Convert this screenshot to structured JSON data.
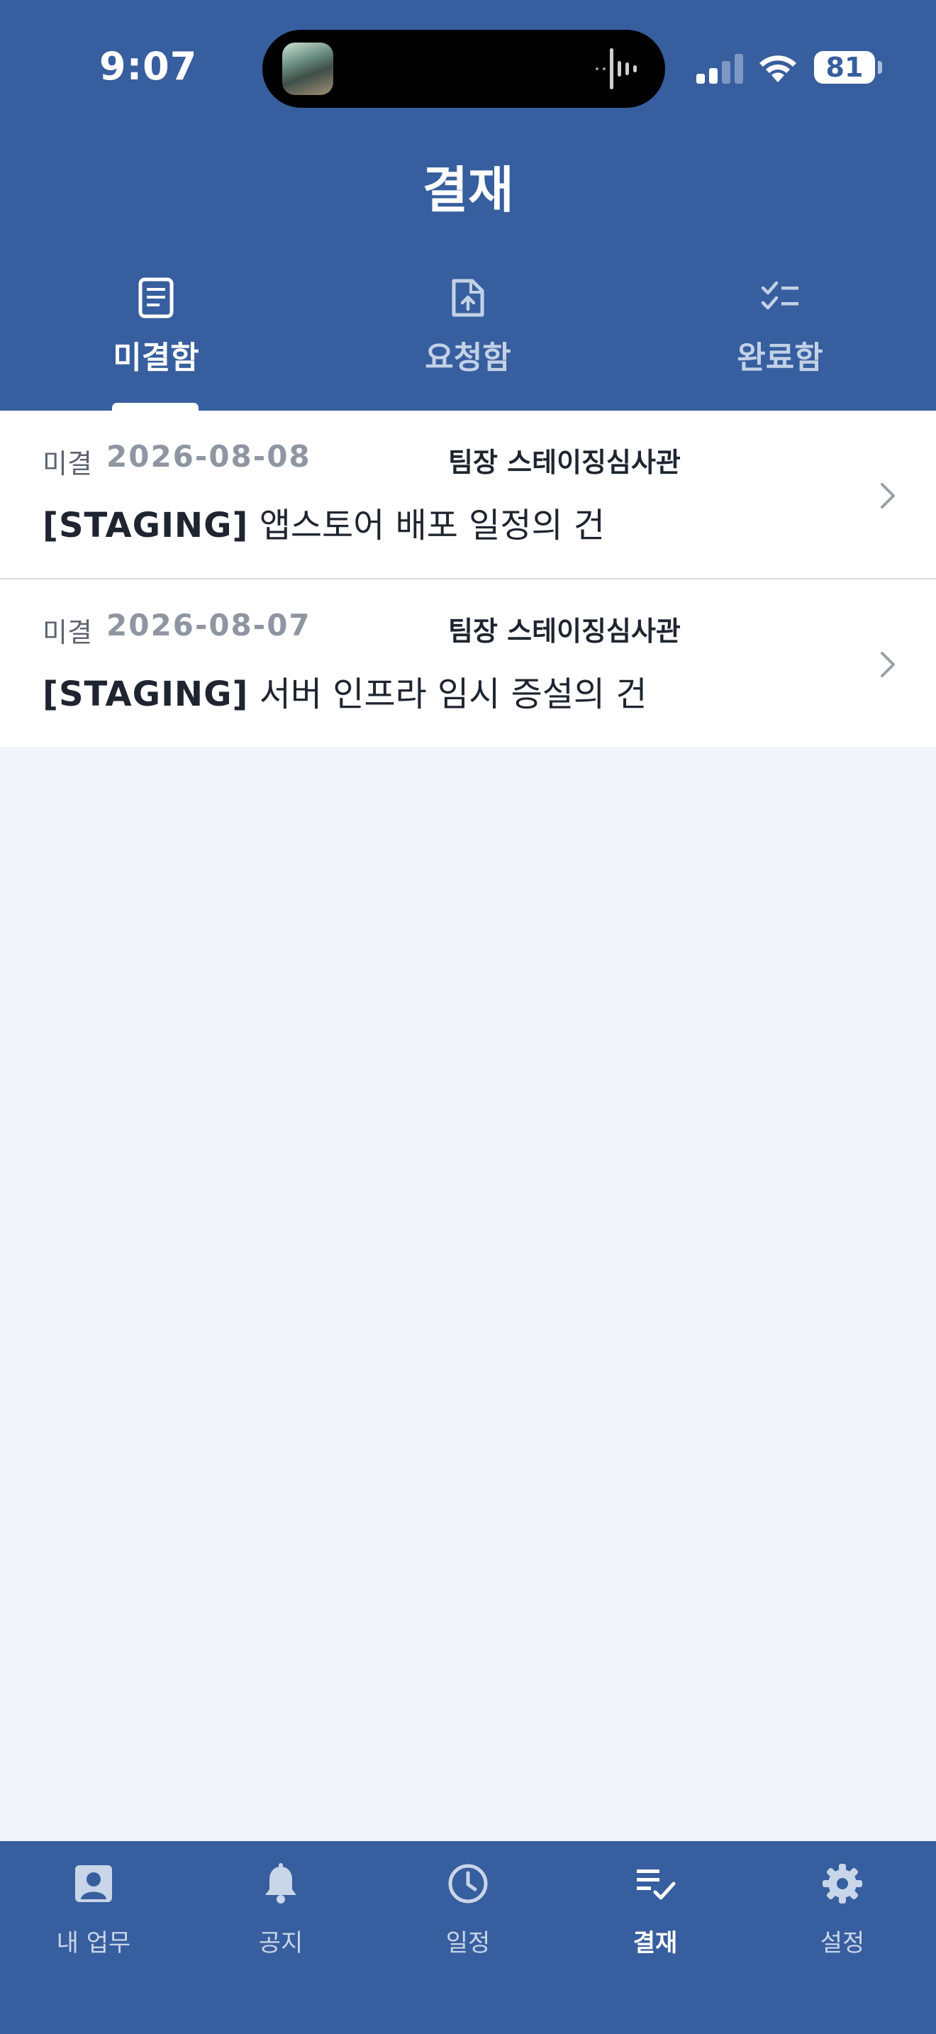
{
  "status_bar": {
    "time": "9:07",
    "battery": "81"
  },
  "header": {
    "title": "결재"
  },
  "tabs": [
    {
      "label": "미결함",
      "icon": "document-list-icon",
      "active": true
    },
    {
      "label": "요청함",
      "icon": "file-upload-icon",
      "active": false
    },
    {
      "label": "완료함",
      "icon": "checklist-icon",
      "active": false
    }
  ],
  "approvals": [
    {
      "status": "미결",
      "date": "2026-08-08",
      "drafter": "팀장 스테이징심사관",
      "tag": "[STAGING]",
      "title": "앱스토어 배포 일정의 건"
    },
    {
      "status": "미결",
      "date": "2026-08-07",
      "drafter": "팀장 스테이징심사관",
      "tag": "[STAGING]",
      "title": "서버 인프라 임시 증설의 건"
    }
  ],
  "bottom_nav": [
    {
      "label": "내 업무",
      "icon": "person-badge-icon",
      "active": false
    },
    {
      "label": "공지",
      "icon": "bell-icon",
      "active": false
    },
    {
      "label": "일정",
      "icon": "clock-icon",
      "active": false
    },
    {
      "label": "결재",
      "icon": "approval-list-icon",
      "active": true
    },
    {
      "label": "설정",
      "icon": "gear-icon",
      "active": false
    }
  ],
  "colors": {
    "primary": "#375e9e",
    "background": "#f1f4f8",
    "text": "#1f2530",
    "muted": "#8f96a1"
  }
}
